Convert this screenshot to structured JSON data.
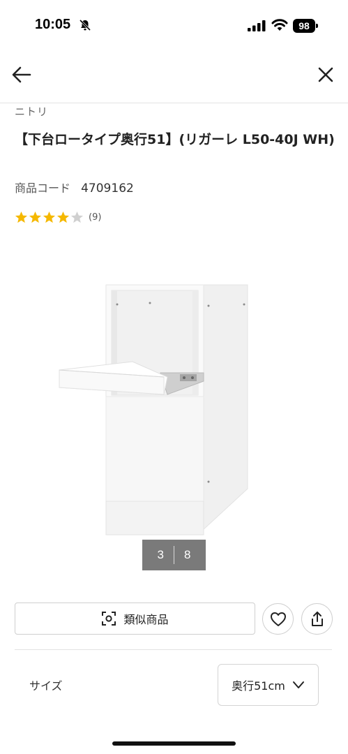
{
  "status_bar": {
    "time": "10:05",
    "battery": "98",
    "icons": [
      "bell-slash-icon",
      "cellular-signal-icon",
      "wifi-icon",
      "battery-icon"
    ]
  },
  "nav": {
    "back_icon": "arrow-left-icon",
    "close_icon": "close-icon"
  },
  "product": {
    "brand": "ニトリ",
    "title": "【下台ロータイプ奥行51】(リガーレ L50-40J WH)",
    "code_label": "商品コード",
    "code_value": "4709162",
    "rating": 4,
    "rating_max": 5,
    "review_count": "(9)"
  },
  "gallery": {
    "current": "3",
    "total": "8",
    "image": "white-cabinet-with-slide-out-shelf"
  },
  "actions": {
    "similar_label": "類似商品",
    "similar_icon": "scan-icon",
    "favorite_icon": "heart-icon",
    "share_icon": "share-icon"
  },
  "options": {
    "size_label": "サイズ",
    "size_value": "奥行51cm",
    "size_icon": "chevron-down-icon"
  },
  "colors": {
    "star_filled": "#f5b800",
    "star_empty": "#d0d0d0",
    "counter_bg": "#7a7a7a"
  }
}
